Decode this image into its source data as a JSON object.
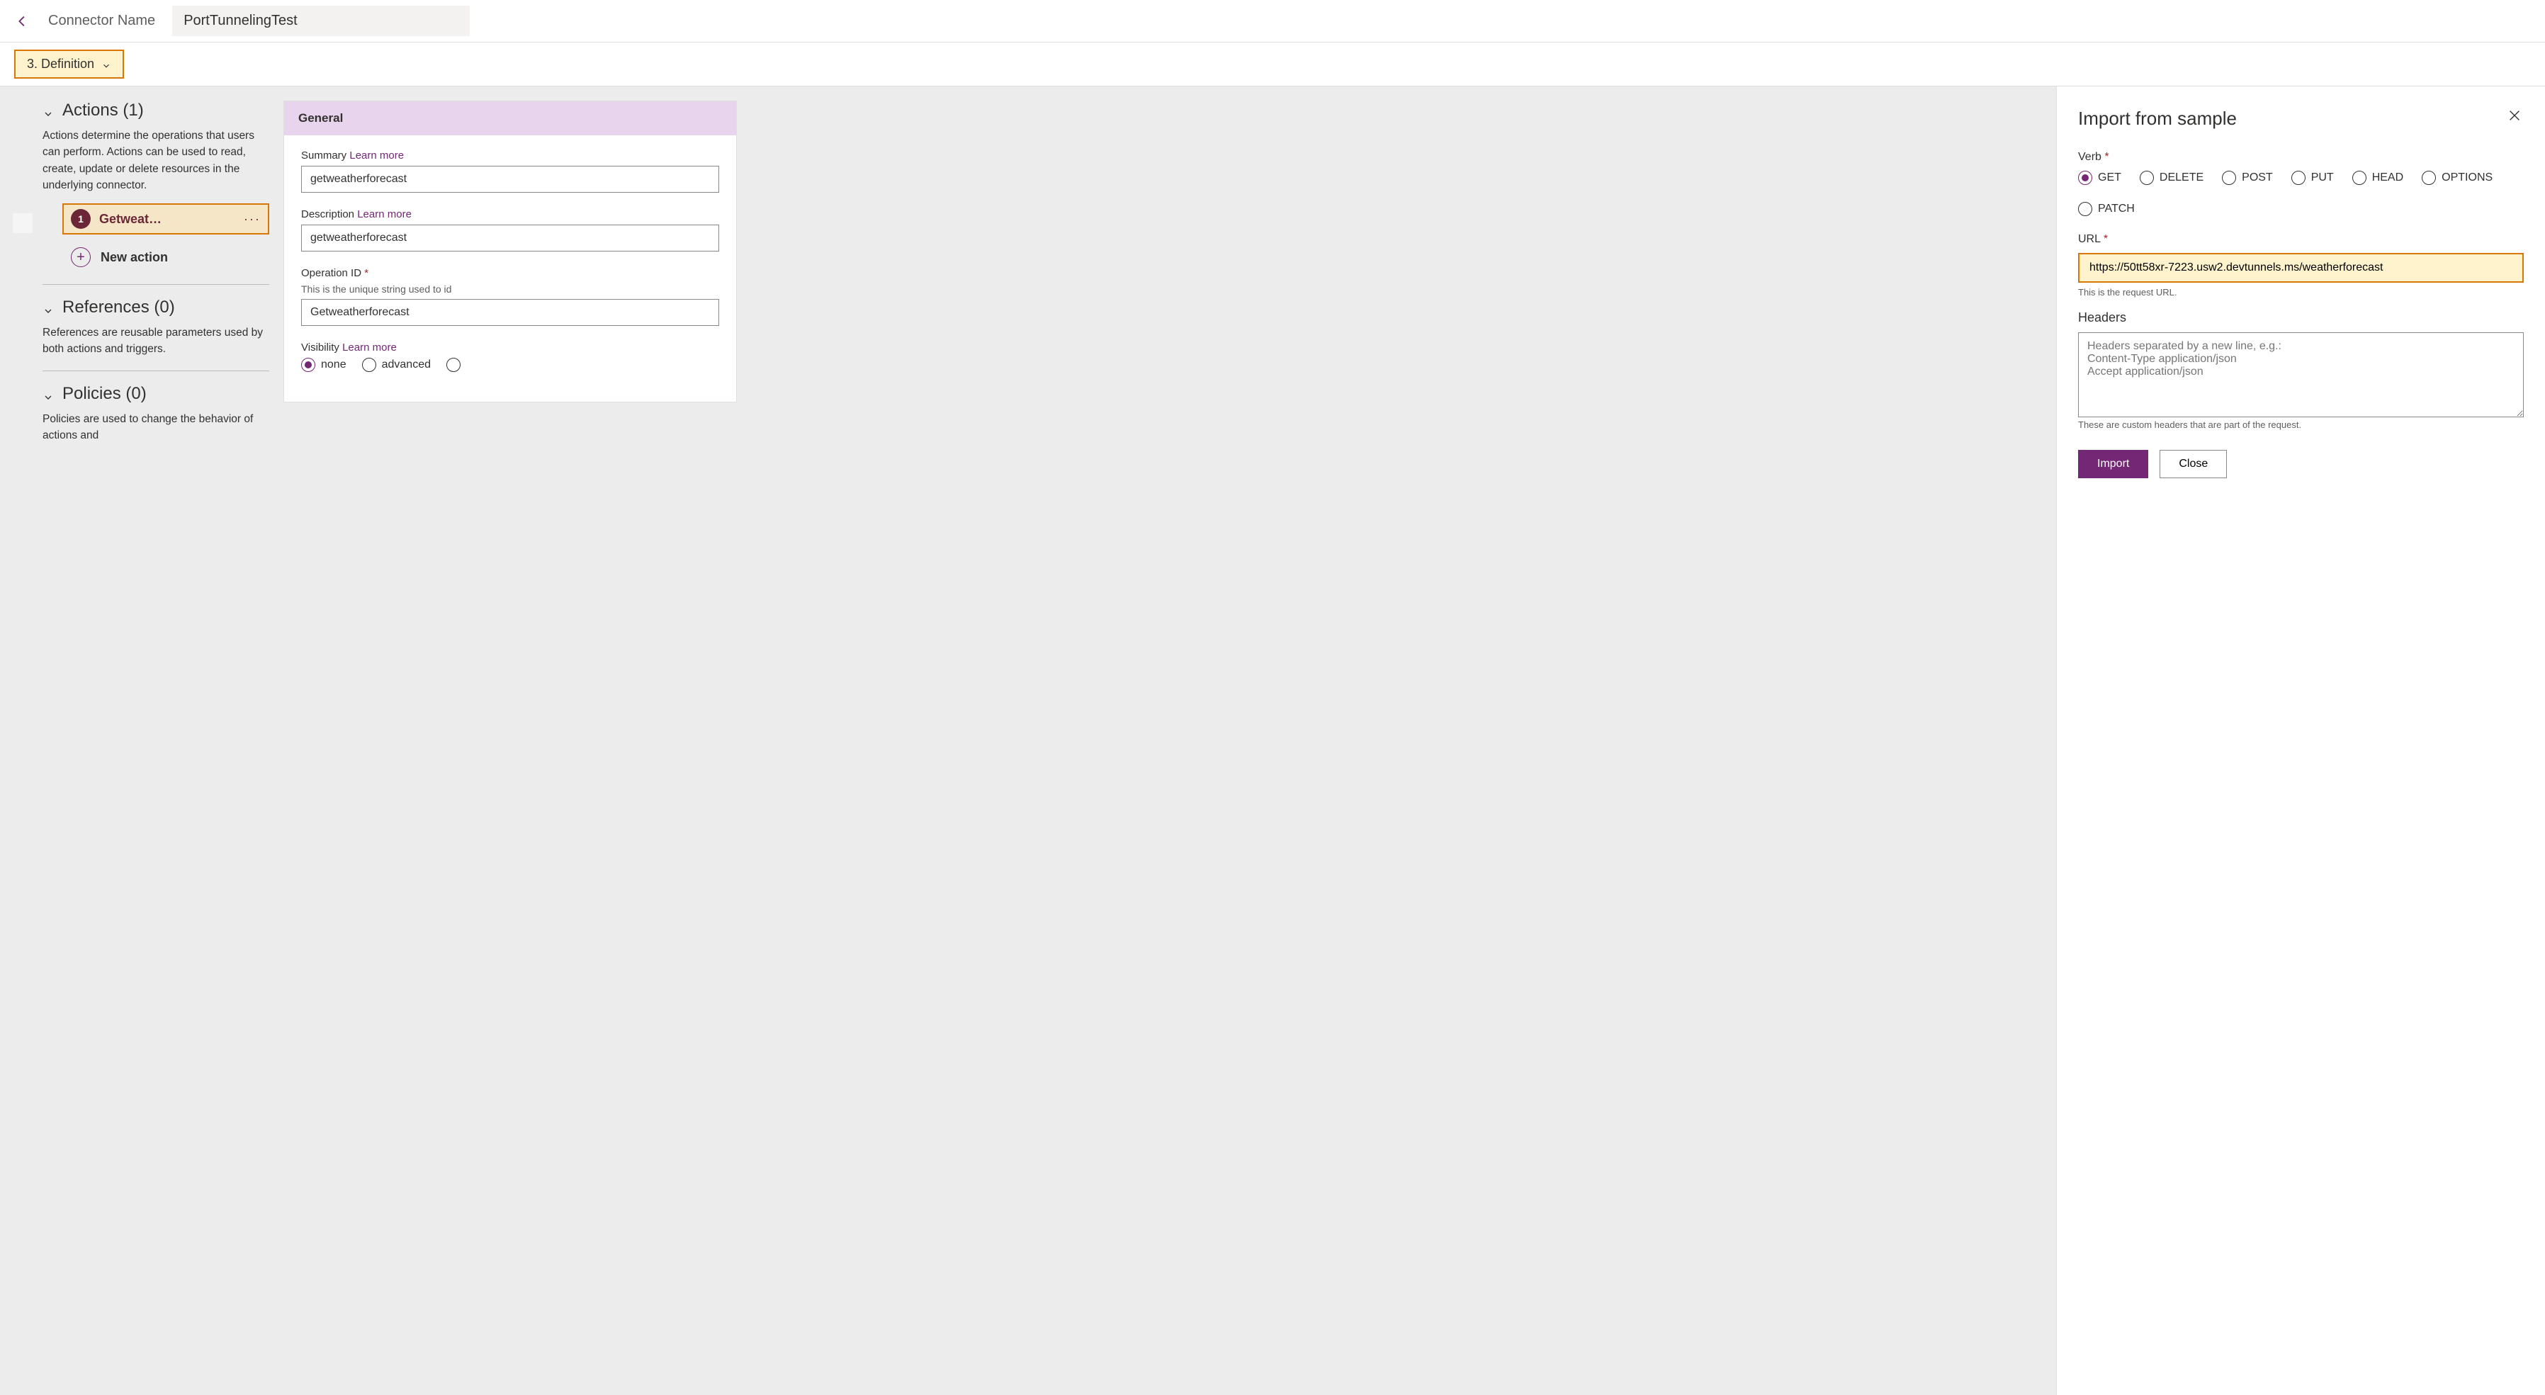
{
  "topbar": {
    "connector_label": "Connector Name",
    "connector_value": "PortTunnelingTest"
  },
  "step": {
    "label": "3. Definition"
  },
  "sections": {
    "actions": {
      "title": "Actions (1)",
      "desc": "Actions determine the operations that users can perform. Actions can be used to read, create, update or delete resources in the underlying connector.",
      "item_badge": "1",
      "item_name": "Getweat…",
      "new_label": "New action"
    },
    "references": {
      "title": "References (0)",
      "desc": "References are reusable parameters used by both actions and triggers."
    },
    "policies": {
      "title": "Policies (0)",
      "desc": "Policies are used to change the behavior of actions and"
    }
  },
  "general": {
    "header": "General",
    "summary_label": "Summary",
    "learn_more": "Learn more",
    "summary_value": "getweatherforecast",
    "description_label": "Description",
    "description_value": "getweatherforecast",
    "opid_label": "Operation ID",
    "opid_help": "This is the unique string used to id",
    "opid_value": "Getweatherforecast",
    "visibility_label": "Visibility",
    "vis_none": "none",
    "vis_advanced": "advanced"
  },
  "panel": {
    "title": "Import from sample",
    "verb_label": "Verb",
    "verbs": {
      "get": "GET",
      "delete": "DELETE",
      "post": "POST",
      "put": "PUT",
      "head": "HEAD",
      "options": "OPTIONS",
      "patch": "PATCH"
    },
    "verb_selected": "GET",
    "url_label": "URL",
    "url_value": "https://50tt58xr-7223.usw2.devtunnels.ms/weatherforecast",
    "url_help": "This is the request URL.",
    "headers_label": "Headers",
    "headers_placeholder": "Headers separated by a new line, e.g.:\nContent-Type application/json\nAccept application/json",
    "headers_help": "These are custom headers that are part of the request.",
    "import_btn": "Import",
    "close_btn": "Close"
  }
}
